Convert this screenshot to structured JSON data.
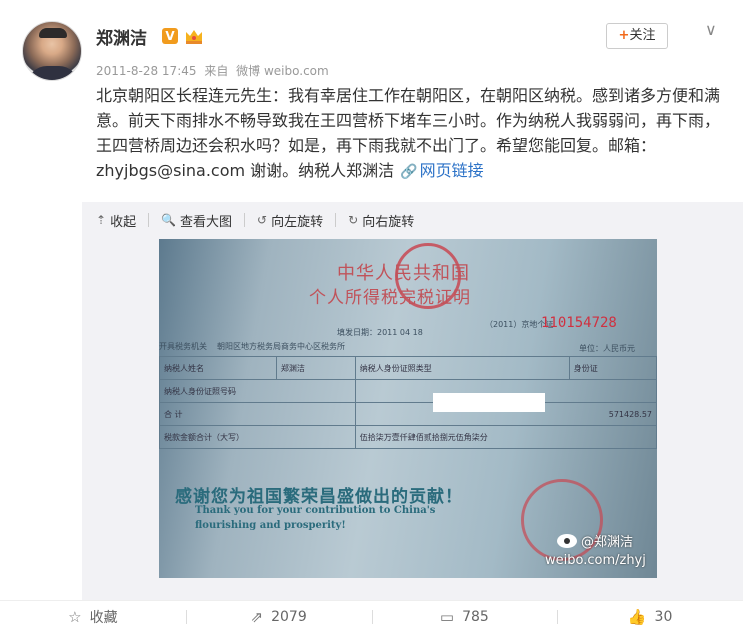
{
  "post": {
    "author": "郑渊洁",
    "vip_badge": "V",
    "follow_label": "关注",
    "timestamp": "2011-8-28 17:45",
    "source_prefix": "来自",
    "source": "微博 weibo.com",
    "text": "北京朝阳区长程连元先生：我有幸居住工作在朝阳区，在朝阳区纳税。感到诸多方便和满意。前天下雨排水不畅导致我在王四营桥下堵车三小时。作为纳税人我弱弱问，再下雨，王四营桥周边还会积水吗？如是，再下雨我就不出门了。希望您能回复。邮箱：zhyjbgs@sina.com 谢谢。纳税人郑渊洁",
    "link_label": "网页链接"
  },
  "media_toolbar": {
    "collapse": "收起",
    "view_large": "查看大图",
    "rotate_left": "向左旋转",
    "rotate_right": "向右旋转"
  },
  "photo": {
    "title1": "中华人民共和国",
    "title2": "个人所得税完税证明",
    "serial_prefix": "（2011）京地个证",
    "serial": "110154728",
    "fill_date": "填发日期：2011   04   18",
    "issuer_label": "开具税务机关",
    "issuer": "朝阳区地方税务局商务中心区税务所",
    "unit_label": "单位：人民币元",
    "row1": [
      "纳税人姓名",
      "郑渊洁",
      "纳税人身份证照类型",
      "身份证"
    ],
    "row2_label": "纳税人身份证照号码",
    "total_label": "合    计",
    "total_value": "571428.57",
    "amount_label": "税款金额合计（大写）",
    "amount_text": "伍拾柒万壹仟肆佰贰拾捌元伍角柒分",
    "thanks": "感谢您为祖国繁荣昌盛做出的贡献！",
    "thanks_en1": "Thank you for your contribution to China's",
    "thanks_en2": "flourishing and prosperity!",
    "watermark_name": "@郑渊洁",
    "watermark_url": "weibo.com/zhyj"
  },
  "actions": {
    "favorite": "收藏",
    "repost_count": "2079",
    "comment_count": "785",
    "like_count": "30"
  },
  "colors": {
    "link": "#2c72c7",
    "vip": "#f19b1d",
    "follow_plus": "#f26a1b"
  }
}
